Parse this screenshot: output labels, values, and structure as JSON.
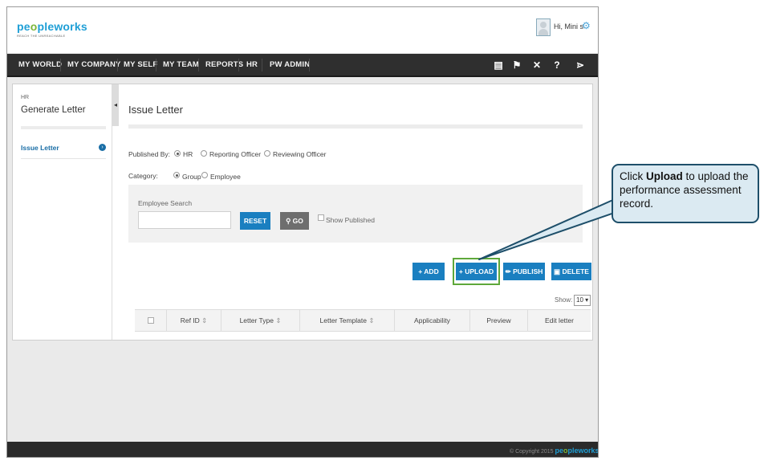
{
  "header": {
    "logo_text_pre": "pe",
    "logo_text_acc": "o",
    "logo_text_post": "pleworks",
    "logo_tagline": "REACH THE UNREACHABLE",
    "greeting": "Hi, Mini s"
  },
  "nav": {
    "items": [
      "MY WORLD",
      "MY COMPANY",
      "MY SELF",
      "MY TEAM",
      "REPORTS",
      "HR",
      "PW ADMIN"
    ],
    "icons": [
      "book-icon",
      "flag-icon",
      "tools-icon",
      "help-icon",
      "share-icon"
    ]
  },
  "sidebar": {
    "breadcrumb": "HR",
    "title": "Generate Letter",
    "items": [
      {
        "label": "Issue Letter"
      }
    ]
  },
  "main": {
    "title": "Issue Letter",
    "published_by_label": "Published By:",
    "published_by_options": [
      "HR",
      "Reporting Officer",
      "Reviewing Officer"
    ],
    "published_by_selected": "HR",
    "category_label": "Category:",
    "category_options": [
      "Group",
      "Employee"
    ],
    "category_selected": "Group",
    "employee_search_label": "Employee Search",
    "employee_search_value": "",
    "reset_label": "RESET",
    "go_label": "GO",
    "show_published_label": "Show Published",
    "actions": {
      "add": "ADD",
      "upload": "UPLOAD",
      "publish": "PUBLISH",
      "delete": "DELETE"
    },
    "show_label": "Show:",
    "show_value": "10",
    "table_columns": [
      "Ref ID",
      "Letter Type",
      "Letter Template",
      "Applicability",
      "Preview",
      "Edit letter"
    ]
  },
  "footer": {
    "copyright": "© Copyright 2015",
    "logo_pre": "pe",
    "logo_acc": "o",
    "logo_post": "pleworks"
  },
  "callout": {
    "prefix": "Click ",
    "bold": "Upload",
    "suffix": " to upload the performance assessment record."
  },
  "colors": {
    "brand": "#1f9fd6",
    "accent": "#7bb63a",
    "primary_button": "#1a7fc0",
    "navbar": "#2f2f2f",
    "highlight": "#5ea83a",
    "callout_fill": "#dbeaf2",
    "callout_border": "#1e4f6a"
  }
}
